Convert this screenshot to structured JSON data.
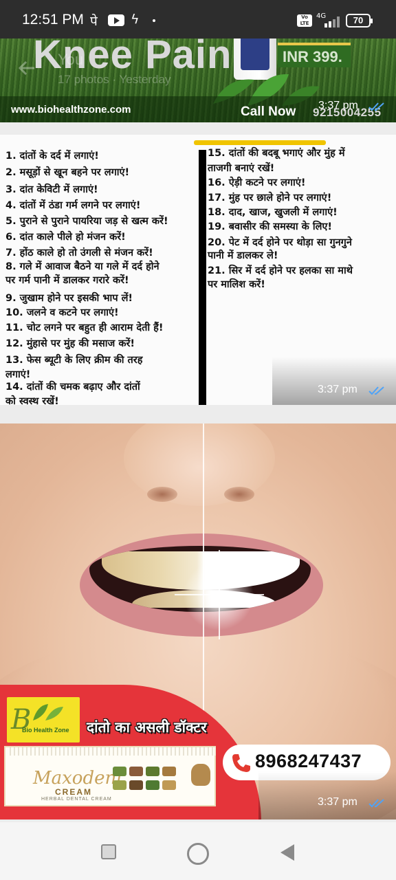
{
  "status_bar": {
    "time": "12:51 PM",
    "carrier_glyph": "पे",
    "icons": [
      "youtube-icon",
      "flash-icon",
      "dot-icon"
    ],
    "volte_label": "Vo\nLTE",
    "network": "4G",
    "battery": "70"
  },
  "overlay": {
    "sender": "You",
    "subtitle": "17 photos · Yesterday"
  },
  "messages": [
    {
      "headline": "Knee Pain",
      "price": "INR 399.",
      "website": "www.biohealthzone.com",
      "call_label": "Call Now",
      "call_number": "9215004255",
      "time": "3:37 pm"
    },
    {
      "left_list": [
        "1. दांतों के दर्द में लगाएं!",
        "2. मसूड़ों से खून बहने पर लगाएं!",
        "3. दांत केविटी में लगाएं!",
        "4. दांतों में ठंडा गर्म लगने पर लगाएं!",
        "5. पुराने से पुराने पायरिया जड़ से खत्म करें!",
        "6. दांत काले पीले हो मंजन करें!",
        "7. होंठ काले हो तो उंगली से मंजन करें!",
        "8. गले में आवाज बैठने या गले में दर्द होने",
        "पर गर्म पानी में डालकर गरारे करें!",
        "9. जुखाम होने पर इसकी भाप लें!",
        "10. जलने व कटने पर लगाएं!",
        "11. चोट लगने पर बहुत ही आराम देती हैं!",
        "12. मुंहासे पर मुंह की मसाज करें!",
        "13. फेस ब्यूटी के लिए क्रीम की तरह",
        "लगाएं!",
        "14. दांतों की चमक बढ़ाए और दांतों",
        "को स्वस्थ रखें!"
      ],
      "right_list": [
        "15. दांतों की बदबू भगाएं और मुंह में",
        "ताजगी बनाएं रखें!",
        "16. ऐड़ी कटने पर लगाएं!",
        "17. मुंह पर छाले होने पर लगाएं!",
        "18. दाद, खाज, खुजली में लगाएं!",
        "19. बवासीर की समस्या के लिए!",
        "20. पेट में दर्द होने पर थोड़ा सा गुनगुने",
        "पानी में डालकर ले!",
        "21. सिर में दर्द होने पर हलका सा माथे",
        "पर मालिश करें!"
      ],
      "time": "3:37 pm"
    },
    {
      "brand": "Bio Health Zone",
      "brand_initial": "B",
      "tagline": "दांतो का असली डॉक्टर",
      "product_name": "Maxodent",
      "product_type": "CREAM",
      "product_desc": "HERBAL DENTAL CREAM",
      "phone": "8968247437",
      "time": "3:37 pm"
    }
  ],
  "colors": {
    "status_bg": "#2d2d2d",
    "tick_blue": "#4fa3f7",
    "banner_red": "#e5343a",
    "brand_yellow": "#f4e227"
  }
}
